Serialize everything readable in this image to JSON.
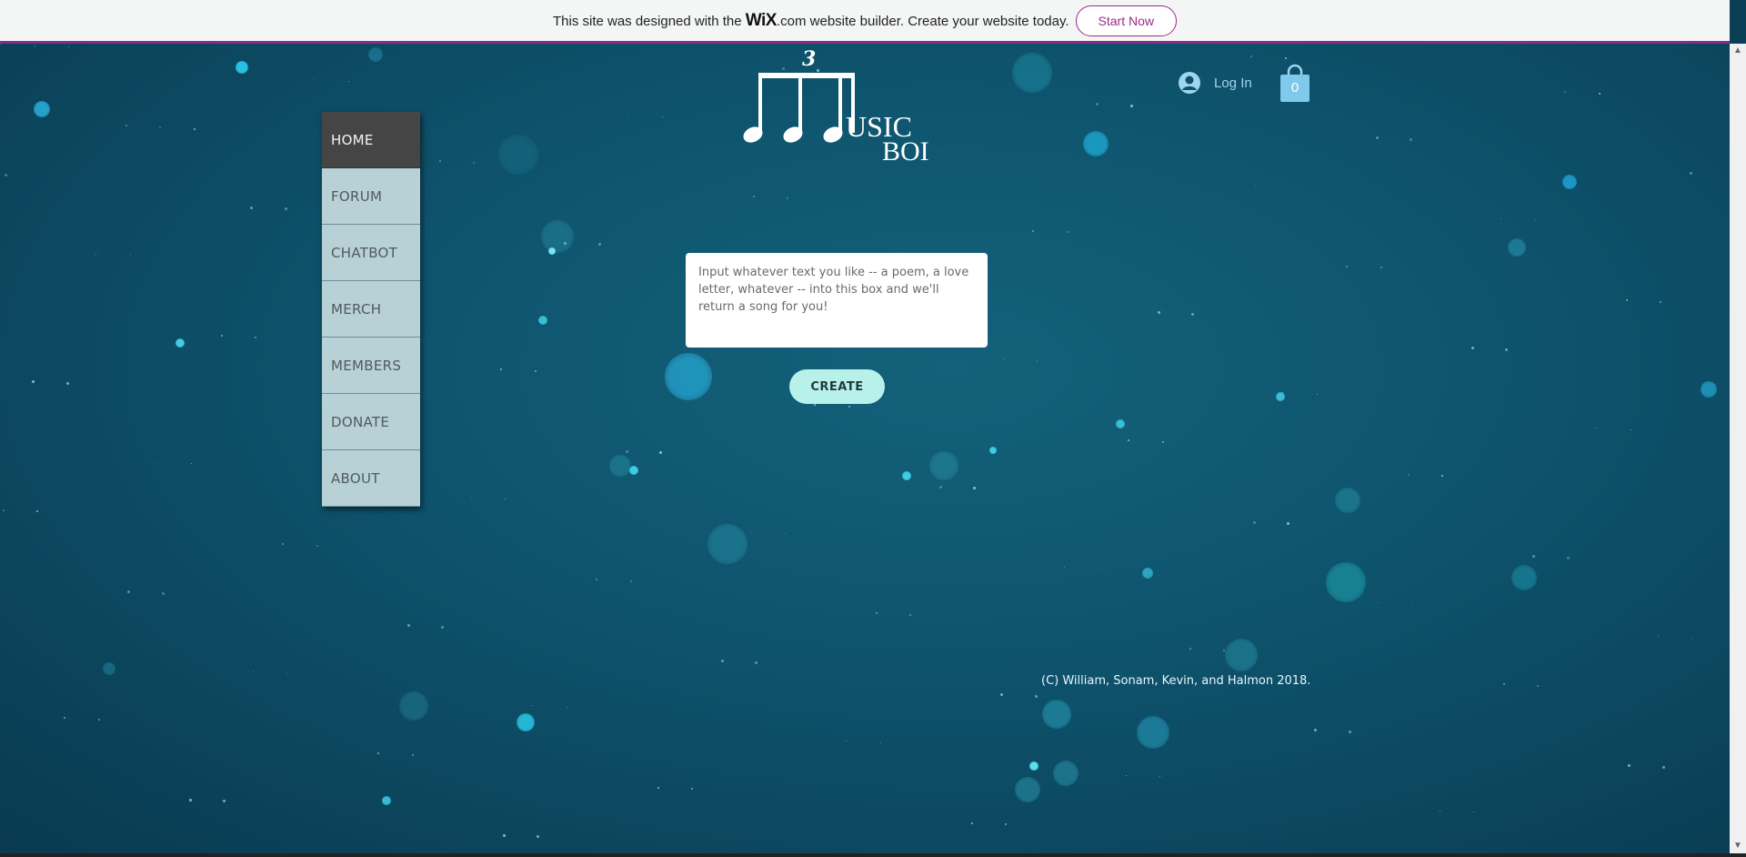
{
  "banner": {
    "text_before": "This site was designed with the ",
    "wix": "WiX",
    "text_after": ".com website builder. Create your website today.",
    "start_button": "Start Now",
    "accent_color": "#9c2a8f"
  },
  "logo": {
    "triplet": "3",
    "line1": "USIC",
    "line2": "BOI"
  },
  "header": {
    "login_label": "Log In",
    "cart_count": "0"
  },
  "nav": {
    "items": [
      {
        "label": "HOME"
      },
      {
        "label": "FORUM"
      },
      {
        "label": "CHATBOT"
      },
      {
        "label": "MERCH"
      },
      {
        "label": "MEMBERS"
      },
      {
        "label": "DONATE"
      },
      {
        "label": "ABOUT"
      }
    ]
  },
  "main": {
    "input_placeholder": "Input whatever text you like -- a poem, a love letter, whatever -- into this box and we'll return a song for you!",
    "create_button": "CREATE"
  },
  "footer": {
    "copyright": "(C) William, Sonam, Kevin, and Halmon 2018."
  },
  "colors": {
    "background": "#0f5670",
    "nav_active": "#454545",
    "nav_item": "#b8d1d7",
    "create_button": "#b8f0ea",
    "login_text": "#9fd6ee"
  }
}
